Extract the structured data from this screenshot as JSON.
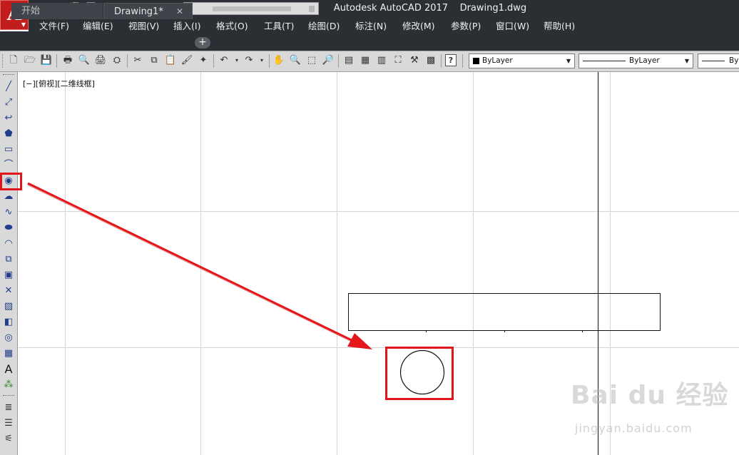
{
  "window": {
    "app_name": "Autodesk AutoCAD 2017",
    "document": "Drawing1.dwg"
  },
  "app_menu_button": {
    "label": "A"
  },
  "menubar": {
    "items": [
      {
        "label": "文件(F)"
      },
      {
        "label": "编辑(E)"
      },
      {
        "label": "视图(V)"
      },
      {
        "label": "插入(I)"
      },
      {
        "label": "格式(O)"
      },
      {
        "label": "工具(T)"
      },
      {
        "label": "绘图(D)"
      },
      {
        "label": "标注(N)"
      },
      {
        "label": "修改(M)"
      },
      {
        "label": "参数(P)"
      },
      {
        "label": "窗口(W)"
      },
      {
        "label": "帮助(H)"
      }
    ]
  },
  "tabs": [
    {
      "label": "开始",
      "active": false
    },
    {
      "label": "Drawing1*",
      "active": true,
      "close_icon": "close-icon"
    }
  ],
  "new_tab_label": "+",
  "toolbar": {
    "color_combo": "ByLayer",
    "linetype_combo": "ByLayer",
    "lineweight_combo": "By",
    "help_label": "?"
  },
  "left_toolbar": {
    "icons": [
      "line-icon",
      "construction-line-icon",
      "polyline-icon",
      "polygon-icon",
      "rectangle-icon",
      "arc-icon",
      "circle-icon",
      "revision-cloud-icon",
      "spline-icon",
      "ellipse-icon",
      "ellipse-arc-icon",
      "insert-block-icon",
      "make-block-icon",
      "point-icon",
      "hatch-icon",
      "gradient-icon",
      "region-icon",
      "table-icon",
      "multiline-text-icon",
      "add-selected-icon",
      "layer-icon",
      "layer-states-icon",
      "layer-properties-icon"
    ],
    "text_tool_label": "A",
    "highlighted": "circle-icon"
  },
  "viewport": {
    "label": "[−][俯视][二维线框]"
  },
  "annotation": {
    "highlight_color": "#e0161b",
    "arrow_color": "#e3171c"
  },
  "watermark": {
    "main": "Bai du 经验",
    "sub": "jingyan.baidu.com"
  }
}
